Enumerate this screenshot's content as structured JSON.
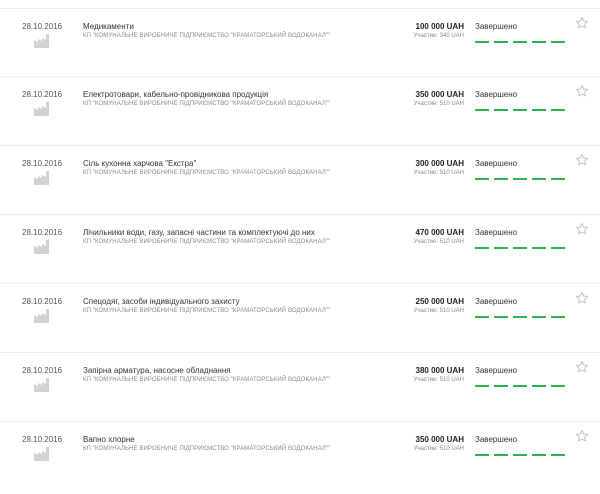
{
  "colors": {
    "progress": "#2bb24c",
    "separator": "#ececec"
  },
  "icons": {
    "row_icon": "factory-icon",
    "favorite": "star-outline-icon"
  },
  "tenders": [
    {
      "date": "28.10.2016",
      "title": "Медикаменти",
      "organization": "КП \"КОМУНАЛЬНЕ ВИРОБНИЧЕ ПІДПРИЄМСТВО \"КРАМАТОРСЬКИЙ ВОДОКАНАЛ\"\"",
      "amount": "100 000 UAH",
      "participation": "Участие: 340 UAH",
      "status": "Завершено",
      "progress_completed_steps": 5,
      "progress_total_steps": 5
    },
    {
      "date": "28.10.2016",
      "title": "Електротовари, кабельно-провідникова продукція",
      "organization": "КП \"КОМУНАЛЬНЕ ВИРОБНИЧЕ ПІДПРИЄМСТВО \"КРАМАТОРСЬКИЙ ВОДОКАНАЛ\"\"",
      "amount": "350 000 UAH",
      "participation": "Участие: 510 UAH",
      "status": "Завершено",
      "progress_completed_steps": 5,
      "progress_total_steps": 5
    },
    {
      "date": "28.10.2016",
      "title": "Сіль кухонна харчова \"Екстра\"",
      "organization": "КП \"КОМУНАЛЬНЕ ВИРОБНИЧЕ ПІДПРИЄМСТВО \"КРАМАТОРСЬКИЙ ВОДОКАНАЛ\"\"",
      "amount": "300 000 UAH",
      "participation": "Участие: 510 UAH",
      "status": "Завершено",
      "progress_completed_steps": 5,
      "progress_total_steps": 5
    },
    {
      "date": "28.10.2016",
      "title": "Лічильники води, газу, запасні частини та комплектуючі до них",
      "organization": "КП \"КОМУНАЛЬНЕ ВИРОБНИЧЕ ПІДПРИЄМСТВО \"КРАМАТОРСЬКИЙ ВОДОКАНАЛ\"\"",
      "amount": "470 000 UAH",
      "participation": "Участие: 510 UAH",
      "status": "Завершено",
      "progress_completed_steps": 5,
      "progress_total_steps": 5
    },
    {
      "date": "28.10.2016",
      "title": "Спецодяг, засоби індивідуального захисту",
      "organization": "КП \"КОМУНАЛЬНЕ ВИРОБНИЧЕ ПІДПРИЄМСТВО \"КРАМАТОРСЬКИЙ ВОДОКАНАЛ\"\"",
      "amount": "250 000 UAH",
      "participation": "Участие: 510 UAH",
      "status": "Завершено",
      "progress_completed_steps": 5,
      "progress_total_steps": 5
    },
    {
      "date": "28.10.2016",
      "title": "Запірна арматура, насосне обладнання",
      "organization": "КП \"КОМУНАЛЬНЕ ВИРОБНИЧЕ ПІДПРИЄМСТВО \"КРАМАТОРСЬКИЙ ВОДОКАНАЛ\"\"",
      "amount": "380 000 UAH",
      "participation": "Участие: 510 UAH",
      "status": "Завершено",
      "progress_completed_steps": 5,
      "progress_total_steps": 5
    },
    {
      "date": "28.10.2016",
      "title": "Вапно хлорне",
      "organization": "КП \"КОМУНАЛЬНЕ ВИРОБНИЧЕ ПІДПРИЄМСТВО \"КРАМАТОРСЬКИЙ ВОДОКАНАЛ\"\"",
      "amount": "350 000 UAH",
      "participation": "Участие: 510 UAH",
      "status": "Завершено",
      "progress_completed_steps": 5,
      "progress_total_steps": 5
    }
  ]
}
